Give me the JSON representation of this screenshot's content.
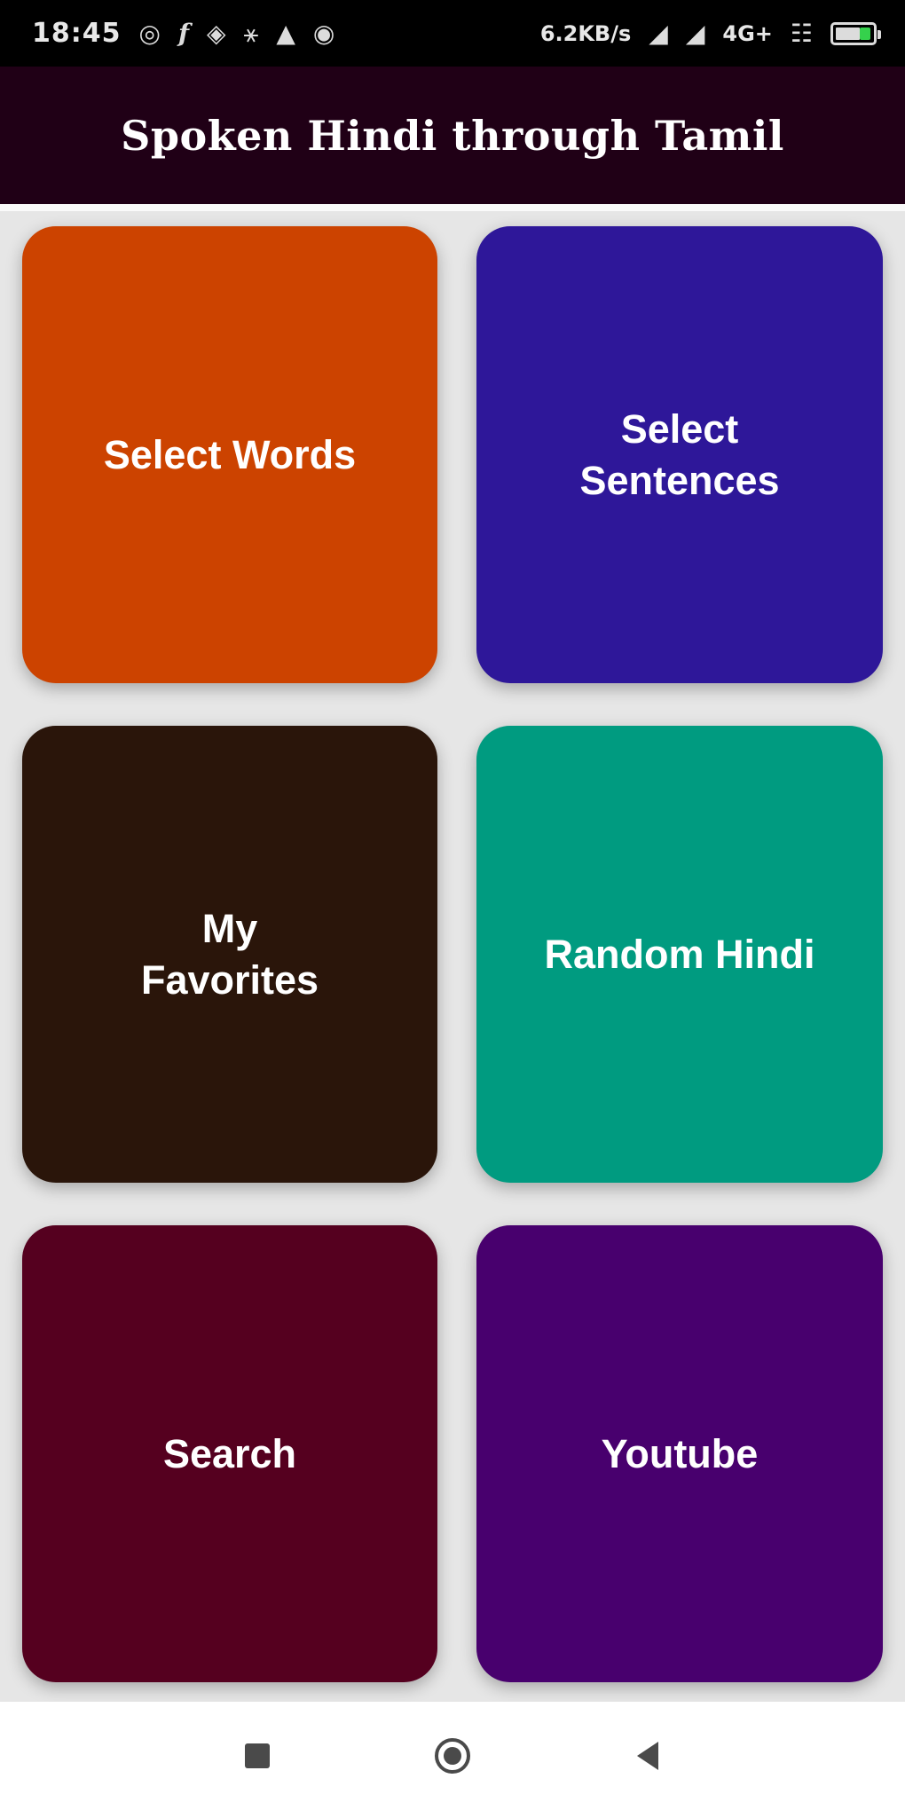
{
  "status_bar": {
    "time": "18:45",
    "speed": "6.2KB/s",
    "network": "4G+",
    "icons": [
      "sync-icon",
      "facebook-icon",
      "app-icon",
      "usb-icon",
      "warning-icon",
      "shield-icon",
      "signal-icon",
      "signal-icon",
      "volte-icon",
      "battery-icon"
    ]
  },
  "app_bar": {
    "title": "Spoken Hindi through Tamil",
    "background": "#200016"
  },
  "tiles": [
    {
      "label": "Select Words",
      "color": "#cc4300"
    },
    {
      "label": "Select Sentences",
      "color": "#2e1799"
    },
    {
      "label": "My Favorites",
      "color": "#2a150a"
    },
    {
      "label": "Random Hindi",
      "color": "#009b80"
    },
    {
      "label": "Search",
      "color": "#55001f"
    },
    {
      "label": "Youtube",
      "color": "#48006e"
    }
  ],
  "nav_bar": {
    "icons": [
      "recents-icon",
      "home-icon",
      "back-icon"
    ]
  }
}
